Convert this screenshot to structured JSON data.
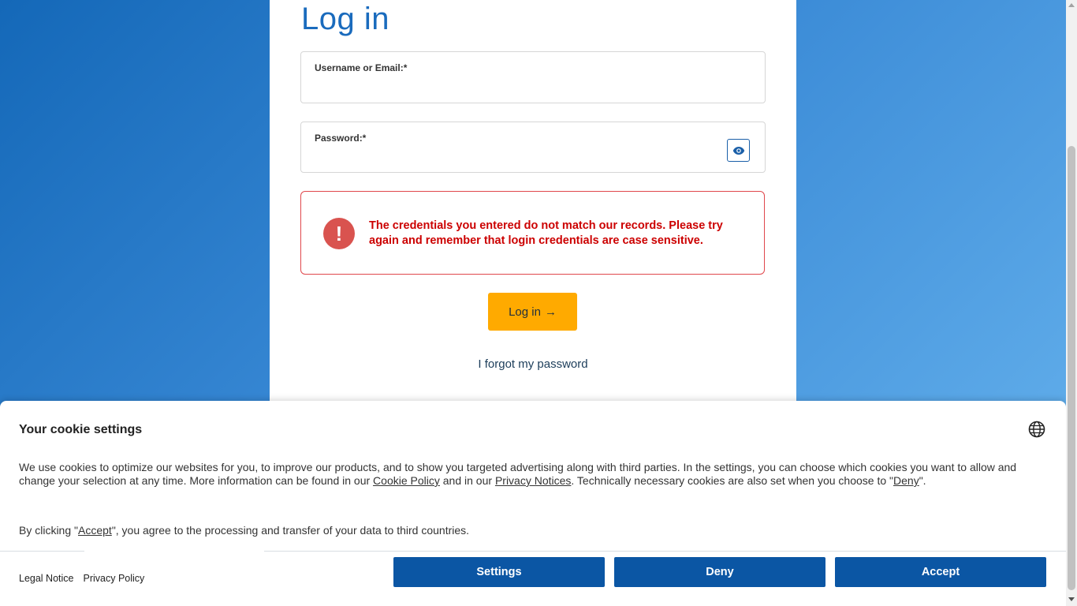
{
  "login": {
    "title": "Log in",
    "username_label": "Username or Email:*",
    "username_value": "",
    "password_label": "Password:*",
    "password_value": "",
    "error_message": "The credentials you entered do not match our records. Please try again and remember that login credentials are case sensitive.",
    "login_button": "Log in",
    "login_button_arrow": "→",
    "forgot_link": "I forgot my password"
  },
  "cookie": {
    "title": "Your cookie settings",
    "text_part1": "We use cookies to optimize our websites for you, to improve our products, and to show you targeted advertising along with third parties. In the settings, you can choose which cookies you want to allow and change your selection at any time. More information can be found in our ",
    "cookie_policy_link": "Cookie Policy",
    "text_part2": " and in our ",
    "privacy_notices_link": "Privacy Notices",
    "text_part3": ". Technically necessary cookies are also set when you choose to \"",
    "deny_link": "Deny",
    "text_part4": "\".",
    "text2_part1": "By clicking \"",
    "accept_link": "Accept",
    "text2_part2": "\", you agree to the processing and transfer of your data to third countries.",
    "legal_notice": "Legal Notice",
    "privacy_policy": "Privacy Policy",
    "settings_button": "Settings",
    "deny_button": "Deny",
    "accept_button": "Accept"
  },
  "colors": {
    "accent_blue": "#1a6bbd",
    "button_yellow": "#ffaa00",
    "error_red": "#cc0000",
    "cookie_button_blue": "#0b56a4"
  },
  "icons": {
    "password_toggle": "eye-icon",
    "error": "exclamation-icon",
    "language": "globe-icon"
  }
}
